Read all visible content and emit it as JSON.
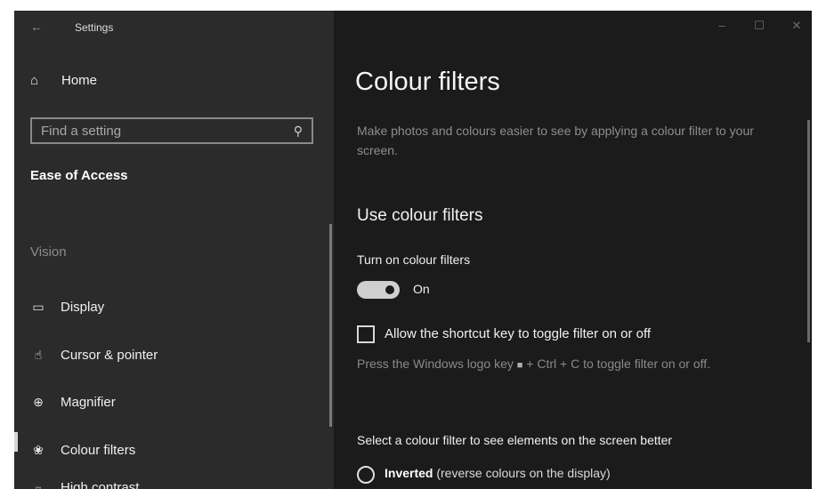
{
  "window": {
    "title": "Settings",
    "back_icon": "back-arrow-icon",
    "controls": {
      "minimize": "–",
      "maximize": "☐",
      "close": "✕"
    }
  },
  "sidebar": {
    "home": {
      "icon": "⌂",
      "label": "Home"
    },
    "search": {
      "placeholder": "Find a setting",
      "icon": "⚲"
    },
    "section_title": "Ease of Access",
    "group_title": "Vision",
    "items": [
      {
        "icon": "▭",
        "label": "Display",
        "selected": false
      },
      {
        "icon": "☝",
        "label": "Cursor & pointer",
        "selected": false
      },
      {
        "icon": "⊕",
        "label": "Magnifier",
        "selected": false
      },
      {
        "icon": "❀",
        "label": "Colour filters",
        "selected": true
      },
      {
        "icon": "☼",
        "label": "High contrast",
        "selected": false
      }
    ]
  },
  "main": {
    "title": "Colour filters",
    "description": "Make photos and colours easier to see by applying a colour filter to your screen.",
    "section_heading": "Use colour filters",
    "toggle": {
      "label": "Turn on colour filters",
      "state_text": "On",
      "on": true
    },
    "shortcut_checkbox": {
      "label": "Allow the shortcut key to toggle filter on or off",
      "checked": false
    },
    "hint": {
      "before_logo": "Press the Windows logo key ",
      "logo_glyph": "■",
      "after_logo": " + Ctrl + C to toggle filter on or off."
    },
    "filter_select_label": "Select a colour filter to see elements on the screen better",
    "radio_option": {
      "name": "Inverted",
      "detail": "(reverse colours on the display)",
      "selected": false
    }
  },
  "colors": {
    "sidebar_bg": "#2b2b2b",
    "main_bg": "#1b1b1b",
    "text_primary": "#f0f0f0",
    "text_secondary": "#8e8e8e"
  }
}
